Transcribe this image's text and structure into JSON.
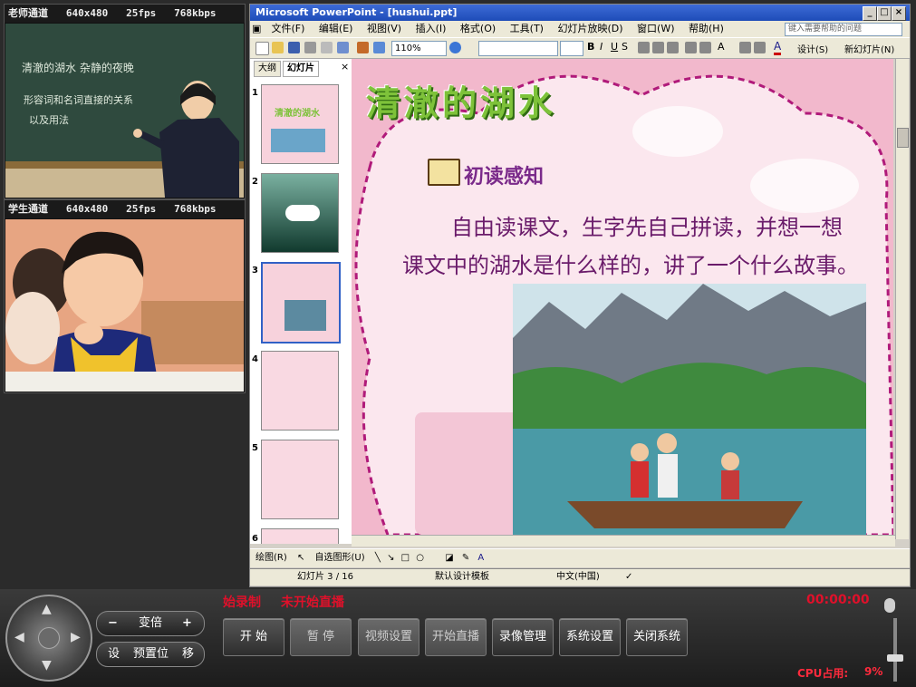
{
  "teacher_channel": {
    "label": "老师通道",
    "res": "640x480",
    "fps": "25fps",
    "bitrate": "768kbps",
    "board_line1": "清澈的湖水  杂静的夜晚",
    "board_line2": "形容词和名词直接的关系",
    "board_line3": "以及用法"
  },
  "student_channel": {
    "label": "学生通道",
    "res": "640x480",
    "fps": "25fps",
    "bitrate": "768kbps"
  },
  "ppt": {
    "title": "Microsoft PowerPoint - [hushui.ppt]",
    "help_placeholder": "键入需要帮助的问题",
    "menu": [
      "文件(F)",
      "编辑(E)",
      "视图(V)",
      "插入(I)",
      "格式(O)",
      "工具(T)",
      "幻灯片放映(D)",
      "窗口(W)",
      "帮助(H)"
    ],
    "zoom": "110%",
    "design_label": "设计(S)",
    "new_slide_label": "新幻灯片(N)",
    "panel_tabs": [
      "大纲",
      "幻灯片"
    ],
    "thumb_numbers": [
      "1",
      "2",
      "3",
      "4",
      "5",
      "6"
    ],
    "thumb1_title": "清澈的湖水",
    "slide": {
      "title": "清澈的湖水",
      "section": "初读感知",
      "line1": "自由读课文，生字先自己拼读，并想一想",
      "line2": "课文中的湖水是什么样的，讲了一个什么故事。"
    },
    "draw_label": "绘图(R)",
    "autoshape_label": "自选图形(U)",
    "status": {
      "slide": "幻灯片 3 / 16",
      "template": "默认设计模板",
      "lang": "中文(中国)"
    }
  },
  "bottom": {
    "status_record": "始录制",
    "status_live": "未开始直播",
    "timer": "00:00:00",
    "zoom_label": "变倍",
    "preset_label": "预置位",
    "preset_left": "设",
    "preset_right": "移",
    "zoom_minus": "−",
    "zoom_plus": "+",
    "buttons": [
      "开  始",
      "暂  停",
      "视频设置",
      "开始直播",
      "录像管理",
      "系统设置",
      "关闭系统"
    ],
    "cpu_label": "CPU占用:",
    "cpu_value": "9%"
  },
  "colors": {
    "title_green": "#7ec23a",
    "title_outline": "#2f6a12",
    "text_purple": "#6a1b6a",
    "record_red": "#e0102a",
    "cpu_red": "#ff2a3c"
  }
}
